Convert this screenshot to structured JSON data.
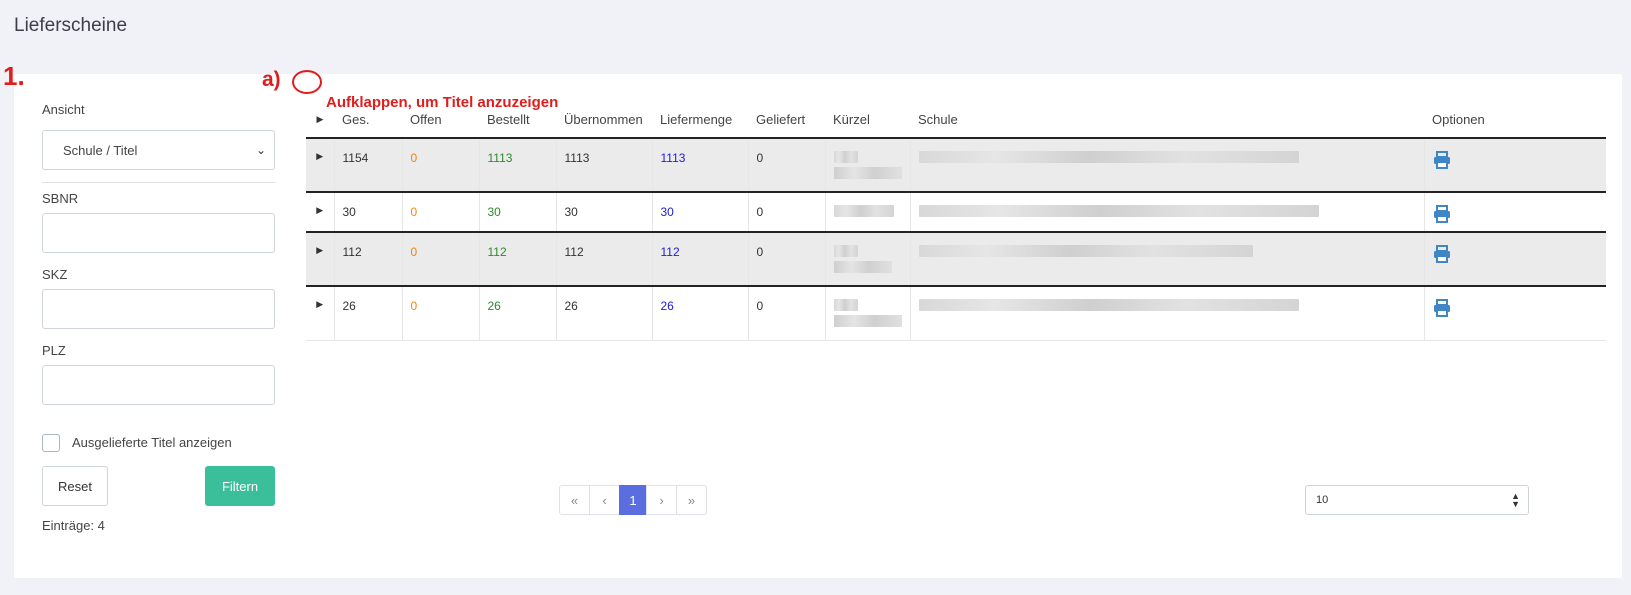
{
  "page": {
    "title": "Lieferscheine"
  },
  "filter": {
    "ansicht_label": "Ansicht",
    "ansicht_value": "Schule / Titel",
    "sbnr_label": "SBNR",
    "skz_label": "SKZ",
    "plz_label": "PLZ",
    "checkbox_label": "Ausgelieferte Titel anzeigen",
    "reset_label": "Reset",
    "filter_label": "Filtern",
    "count_text": "Einträge: 4"
  },
  "annotations": {
    "step": "1.",
    "sub": "a)",
    "hint": "Aufklappen, um Titel anzuzeigen",
    "color": "#e01d1d"
  },
  "table": {
    "columns": [
      "Ges.",
      "Offen",
      "Bestellt",
      "Übernommen",
      "Liefermenge",
      "Geliefert",
      "Kürzel",
      "Schule",
      "Optionen"
    ],
    "rows": [
      {
        "ges": "1154",
        "offen": "0",
        "bestellt": "1113",
        "uebernommen": "1113",
        "liefermenge": "1113",
        "geliefert": "0"
      },
      {
        "ges": "30",
        "offen": "0",
        "bestellt": "30",
        "uebernommen": "30",
        "liefermenge": "30",
        "geliefert": "0"
      },
      {
        "ges": "112",
        "offen": "0",
        "bestellt": "112",
        "uebernommen": "112",
        "liefermenge": "112",
        "geliefert": "0"
      },
      {
        "ges": "26",
        "offen": "0",
        "bestellt": "26",
        "uebernommen": "26",
        "liefermenge": "26",
        "geliefert": "0"
      }
    ]
  },
  "pagination": {
    "first": "«",
    "prev": "‹",
    "current": "1",
    "next": "›",
    "last": "»",
    "page_size": "10"
  },
  "colors": {
    "accent": "#3bbf9a",
    "pager_active": "#5a6ee0",
    "offen": "#f0860c",
    "bestellt": "#2a8c2a",
    "liefermenge": "#2020d6",
    "print_icon": "#3f86c6"
  }
}
